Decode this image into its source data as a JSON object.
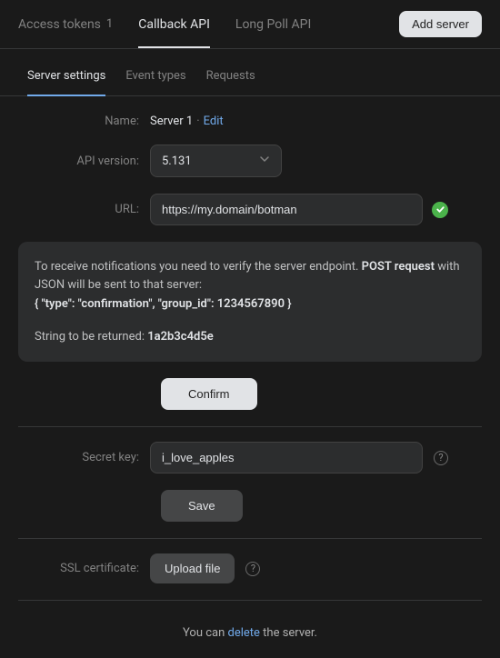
{
  "topTabs": {
    "accessTokens": "Access tokens",
    "accessTokensCount": "1",
    "callbackApi": "Callback API",
    "longPollApi": "Long Poll API"
  },
  "addServerLabel": "Add server",
  "subTabs": {
    "serverSettings": "Server settings",
    "eventTypes": "Event types",
    "requests": "Requests"
  },
  "labels": {
    "name": "Name:",
    "apiVersion": "API version:",
    "url": "URL:",
    "secretKey": "Secret key:",
    "sslCert": "SSL certificate:"
  },
  "serverName": "Server 1",
  "separator": "·",
  "editLabel": "Edit",
  "apiVersionValue": "5.131",
  "urlValue": "https://my.domain/botman",
  "info": {
    "line1a": "To receive notifications you need to verify the server endpoint. ",
    "postRequest": "POST request",
    "line1b": " with JSON will be sent to that server:",
    "jsonExample": "{ \"type\": \"confirmation\", \"group_id\": 1234567890 }",
    "strReturnedLabel": "String to be returned: ",
    "strReturnedValue": "1a2b3c4d5e"
  },
  "confirmLabel": "Confirm",
  "secretKeyValue": "i_love_apples",
  "saveLabel": "Save",
  "uploadFileLabel": "Upload file",
  "deleteText": {
    "prefix": "You can ",
    "delete": "delete",
    "suffix": " the server."
  },
  "helpGlyph": "?"
}
